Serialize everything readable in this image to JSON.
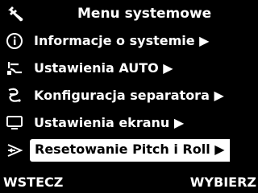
{
  "header": {
    "title": "Menu systemowe",
    "icon": "wrench-icon"
  },
  "menu": {
    "items": [
      {
        "label": "Informacje o systemie ▶",
        "icon": "info-circle-icon",
        "selected": false
      },
      {
        "label": "Ustawienia AUTO ▶",
        "icon": "auto-steer-icon",
        "selected": false
      },
      {
        "label": "Konfiguracja separatora ▶",
        "icon": "separator-icon",
        "selected": false
      },
      {
        "label": "Ustawienia ekranu ▶",
        "icon": "monitor-icon",
        "selected": false
      },
      {
        "label": "Resetowanie Pitch i Roll ▶",
        "icon": "pitch-roll-icon",
        "selected": true
      }
    ]
  },
  "footer": {
    "left_label": "WSTECZ",
    "right_label": "WYBIERZ"
  },
  "colors": {
    "background": "#000000",
    "text": "#ffffff",
    "selection_background": "#ffffff",
    "selection_text": "#000000"
  }
}
